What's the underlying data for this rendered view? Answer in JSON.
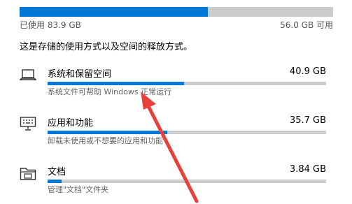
{
  "storage": {
    "used_label": "已使用 83.9 GB",
    "free_label": "56.0 GB 可用",
    "used_fraction": 0.6,
    "description": "这是存储的使用方式以及空间的释放方式。"
  },
  "categories": [
    {
      "name": "系统和保留空间",
      "size": "40.9 GB",
      "subtitle": "系统文件可帮助 Windows 正常运行",
      "fraction": 0.49,
      "icon": "laptop-icon"
    },
    {
      "name": "应用和功能",
      "size": "35.7 GB",
      "subtitle": "卸载未使用或不想要的应用和功能",
      "fraction": 0.43,
      "icon": "keyboard-monitor-icon"
    },
    {
      "name": "文档",
      "size": "3.84 GB",
      "subtitle": "管理\"文档\"文件夹",
      "fraction": 0.05,
      "icon": "folder-icon"
    }
  ],
  "colors": {
    "accent": "#0078d7",
    "track": "#cccccc",
    "annotation": "#e8403a"
  }
}
